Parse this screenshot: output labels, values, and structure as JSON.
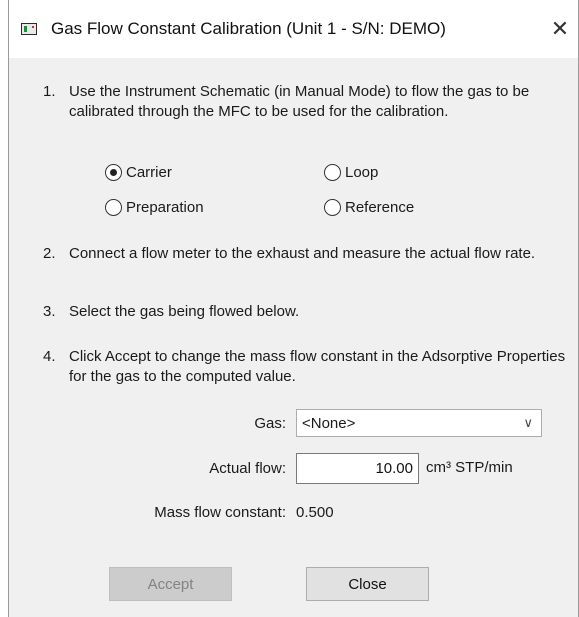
{
  "window": {
    "title": "Gas Flow Constant Calibration (Unit 1 - S/N: DEMO)",
    "close_glyph": "✕"
  },
  "steps": [
    {
      "num": "1.",
      "text": "Use the Instrument Schematic (in Manual Mode) to flow the gas to be calibrated through the MFC to be used for the calibration."
    },
    {
      "num": "2.",
      "text": "Connect a flow meter to the exhaust and measure the actual flow rate."
    },
    {
      "num": "3.",
      "text": "Select the gas being flowed below."
    },
    {
      "num": "4.",
      "text": "Click Accept to change the mass flow constant in the Adsorptive Properties for the gas to the computed value."
    }
  ],
  "radios": [
    {
      "label": "Carrier",
      "checked": true
    },
    {
      "label": "Loop",
      "checked": false
    },
    {
      "label": "Preparation",
      "checked": false
    },
    {
      "label": "Reference",
      "checked": false
    }
  ],
  "form": {
    "gas_label": "Gas:",
    "gas_value": "<None>",
    "flow_label": "Actual flow:",
    "flow_value": "10.00",
    "flow_unit": "cm³ STP/min",
    "constant_label": "Mass flow constant:",
    "constant_value": "0.500"
  },
  "buttons": {
    "accept": "Accept",
    "close": "Close"
  },
  "icons": {
    "app": "app-window-icon",
    "dropdown": "chevron-down-icon",
    "close": "close-icon"
  }
}
